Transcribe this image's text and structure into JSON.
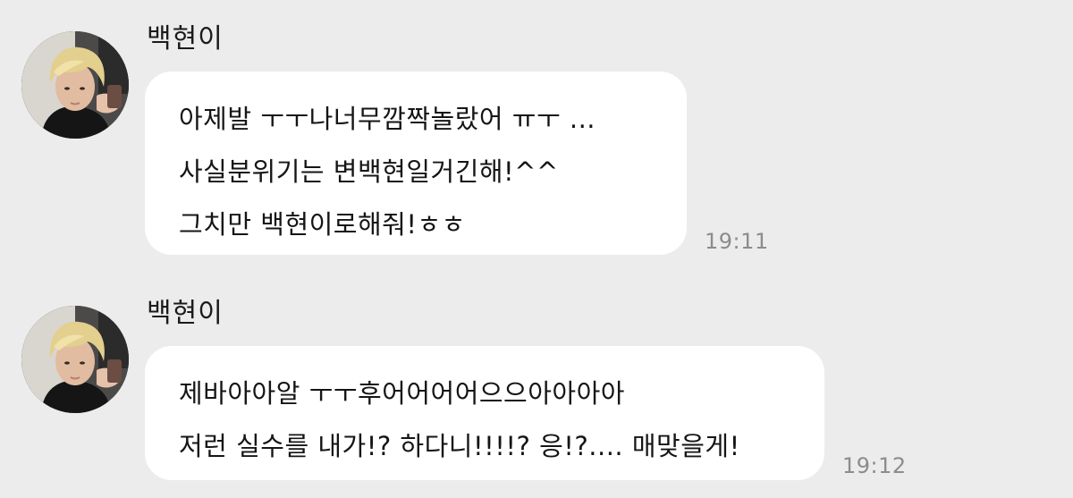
{
  "messages": [
    {
      "sender": "백현이",
      "lines": [
        "아제발 ㅜㅜ나너무깜짝놀랐어 ㅠㅜ ...",
        "사실분위기는 변백현일거긴해!^^",
        "그치만 백현이로해줘!ㅎㅎ"
      ],
      "time": "19:11"
    },
    {
      "sender": "백현이",
      "lines": [
        "제바아아알 ㅜㅜ후어어어어으으아아아아",
        "저런 실수를 내가!? 하다니!!!!? 응!?.... 매맞을게!"
      ],
      "time": "19:12"
    }
  ],
  "colors": {
    "background": "#ececec",
    "bubble": "#ffffff",
    "timestamp": "#8c8c8c"
  }
}
